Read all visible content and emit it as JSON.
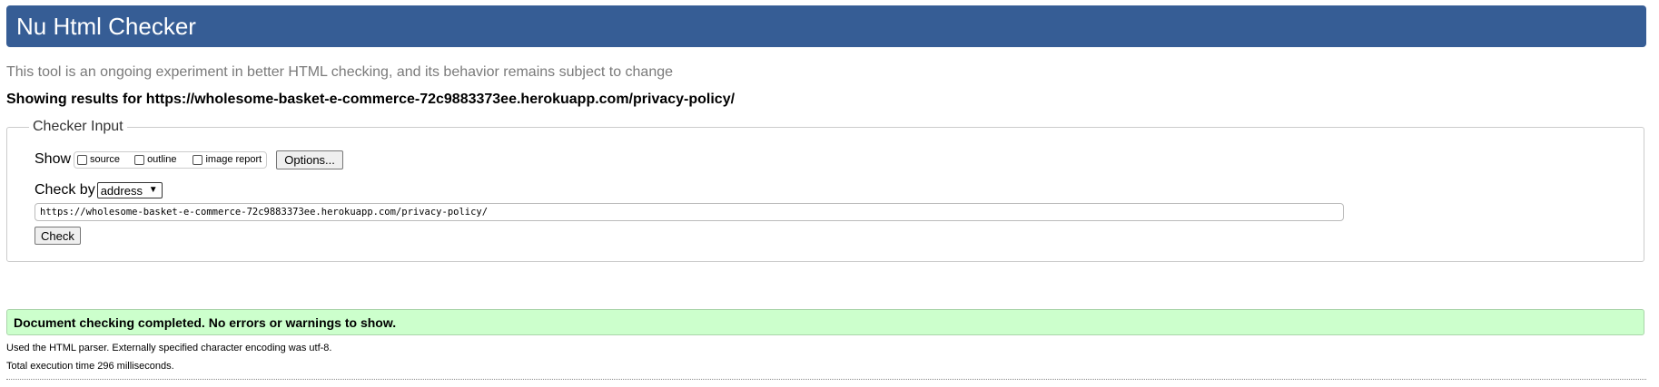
{
  "header": {
    "title": "Nu Html Checker"
  },
  "subtitle": "This tool is an ongoing experiment in better HTML checking, and its behavior remains subject to change",
  "results_for": "Showing results for https://wholesome-basket-e-commerce-72c9883373ee.herokuapp.com/privacy-policy/",
  "checker_input": {
    "legend": "Checker Input",
    "show_label": "Show",
    "checkboxes": [
      {
        "label": "source",
        "checked": false
      },
      {
        "label": "outline",
        "checked": false
      },
      {
        "label": "image report",
        "checked": false
      }
    ],
    "options_label": "Options...",
    "check_by_label": "Check by",
    "check_by_selected": "address",
    "url_value": "https://wholesome-basket-e-commerce-72c9883373ee.herokuapp.com/privacy-policy/",
    "check_label": "Check"
  },
  "result": {
    "message": "Document checking completed. No errors or warnings to show.",
    "color": "#ccffcc"
  },
  "info": {
    "parser": "Used the HTML parser. Externally specified character encoding was utf-8.",
    "execution_time": "Total execution time 296 milliseconds."
  },
  "colors": {
    "header_bg": "#365d95"
  }
}
